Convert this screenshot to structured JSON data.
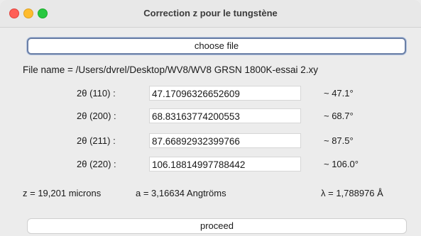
{
  "window": {
    "title": "Correction z pour le tungstène"
  },
  "buttons": {
    "choose_file": "choose file",
    "proceed": "proceed"
  },
  "file": {
    "label": "File name = /Users/dvrel/Desktop/WV8/WV8 GRSN 1800K-essai 2.xy"
  },
  "peaks": [
    {
      "label": "2θ (110) :",
      "value": "47.17096326652609",
      "approx": "~ 47.1°"
    },
    {
      "label": "2θ (200) :",
      "value": "68.83163774200553",
      "approx": "~ 68.7°"
    },
    {
      "label": "2θ (211) :",
      "value": "87.66892932399766",
      "approx": "~ 87.5°"
    },
    {
      "label": "2θ (220) :",
      "value": "106.18814997788442",
      "approx": "~ 106.0°"
    }
  ],
  "results": {
    "z": "z = 19,201 microns",
    "a": "a = 3,16634 Angtröms",
    "lambda": "λ = 1,788976 Å"
  },
  "colors": {
    "close": "#ff5f57",
    "minimize": "#febc2e",
    "maximize": "#28c840",
    "focus_ring": "#6a7fa6"
  }
}
